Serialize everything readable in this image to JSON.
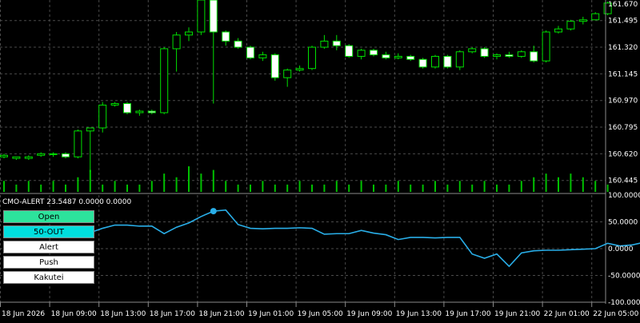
{
  "chart_data": {
    "type": "candlestick",
    "price_axis_labels": [
      "161.670",
      "161.495",
      "161.320",
      "161.145",
      "160.970",
      "160.795",
      "160.620",
      "160.445"
    ],
    "price_axis_values": [
      161.67,
      161.495,
      161.32,
      161.145,
      160.97,
      160.795,
      160.62,
      160.445
    ],
    "price_range": [
      160.37,
      161.63
    ],
    "time_labels": [
      "18 Jun 2026",
      "18 Jun 09:00",
      "18 Jun 13:00",
      "18 Jun 17:00",
      "18 Jun 21:00",
      "19 Jun 01:00",
      "19 Jun 05:00",
      "19 Jun 09:00",
      "19 Jun 13:00",
      "19 Jun 17:00",
      "19 Jun 21:00",
      "22 Jun 01:00",
      "22 Jun 05:00"
    ],
    "time_label_bars": [
      0,
      4,
      8,
      12,
      16,
      20,
      24,
      28,
      32,
      36,
      40,
      44,
      48
    ],
    "candles": [
      {
        "o": 160.6,
        "h": 160.62,
        "l": 160.59,
        "c": 160.61
      },
      {
        "o": 160.59,
        "h": 160.6,
        "l": 160.58,
        "c": 160.6
      },
      {
        "o": 160.59,
        "h": 160.61,
        "l": 160.58,
        "c": 160.6
      },
      {
        "o": 160.61,
        "h": 160.63,
        "l": 160.6,
        "c": 160.62
      },
      {
        "o": 160.62,
        "h": 160.63,
        "l": 160.6,
        "c": 160.62
      },
      {
        "o": 160.62,
        "h": 160.63,
        "l": 160.59,
        "c": 160.6
      },
      {
        "o": 160.6,
        "h": 160.78,
        "l": 160.59,
        "c": 160.77
      },
      {
        "o": 160.77,
        "h": 160.79,
        "l": 160.5,
        "c": 160.79
      },
      {
        "o": 160.79,
        "h": 160.96,
        "l": 160.76,
        "c": 160.94
      },
      {
        "o": 160.94,
        "h": 160.96,
        "l": 160.93,
        "c": 160.95
      },
      {
        "o": 160.95,
        "h": 160.96,
        "l": 160.88,
        "c": 160.89
      },
      {
        "o": 160.89,
        "h": 160.91,
        "l": 160.87,
        "c": 160.9
      },
      {
        "o": 160.9,
        "h": 160.91,
        "l": 160.88,
        "c": 160.89
      },
      {
        "o": 160.89,
        "h": 161.32,
        "l": 160.88,
        "c": 161.31
      },
      {
        "o": 161.31,
        "h": 161.42,
        "l": 161.16,
        "c": 161.4
      },
      {
        "o": 161.4,
        "h": 161.45,
        "l": 161.36,
        "c": 161.42
      },
      {
        "o": 161.42,
        "h": 161.63,
        "l": 161.4,
        "c": 161.63
      },
      {
        "o": 161.63,
        "h": 161.63,
        "l": 160.95,
        "c": 161.42
      },
      {
        "o": 161.42,
        "h": 161.43,
        "l": 161.33,
        "c": 161.36
      },
      {
        "o": 161.36,
        "h": 161.38,
        "l": 161.31,
        "c": 161.32
      },
      {
        "o": 161.32,
        "h": 161.33,
        "l": 161.24,
        "c": 161.25
      },
      {
        "o": 161.25,
        "h": 161.29,
        "l": 161.23,
        "c": 161.27
      },
      {
        "o": 161.27,
        "h": 161.28,
        "l": 161.1,
        "c": 161.12
      },
      {
        "o": 161.12,
        "h": 161.18,
        "l": 161.06,
        "c": 161.17
      },
      {
        "o": 161.17,
        "h": 161.2,
        "l": 161.16,
        "c": 161.18
      },
      {
        "o": 161.18,
        "h": 161.33,
        "l": 161.17,
        "c": 161.32
      },
      {
        "o": 161.32,
        "h": 161.4,
        "l": 161.31,
        "c": 161.36
      },
      {
        "o": 161.36,
        "h": 161.4,
        "l": 161.3,
        "c": 161.33
      },
      {
        "o": 161.33,
        "h": 161.34,
        "l": 161.25,
        "c": 161.26
      },
      {
        "o": 161.26,
        "h": 161.31,
        "l": 161.24,
        "c": 161.3
      },
      {
        "o": 161.3,
        "h": 161.31,
        "l": 161.26,
        "c": 161.27
      },
      {
        "o": 161.27,
        "h": 161.29,
        "l": 161.24,
        "c": 161.25
      },
      {
        "o": 161.25,
        "h": 161.28,
        "l": 161.24,
        "c": 161.26
      },
      {
        "o": 161.26,
        "h": 161.27,
        "l": 161.23,
        "c": 161.24
      },
      {
        "o": 161.24,
        "h": 161.25,
        "l": 161.18,
        "c": 161.19
      },
      {
        "o": 161.19,
        "h": 161.27,
        "l": 161.18,
        "c": 161.26
      },
      {
        "o": 161.26,
        "h": 161.27,
        "l": 161.18,
        "c": 161.19
      },
      {
        "o": 161.19,
        "h": 161.3,
        "l": 161.17,
        "c": 161.29
      },
      {
        "o": 161.29,
        "h": 161.32,
        "l": 161.28,
        "c": 161.31
      },
      {
        "o": 161.31,
        "h": 161.32,
        "l": 161.25,
        "c": 161.26
      },
      {
        "o": 161.26,
        "h": 161.28,
        "l": 161.24,
        "c": 161.27
      },
      {
        "o": 161.27,
        "h": 161.29,
        "l": 161.25,
        "c": 161.26
      },
      {
        "o": 161.26,
        "h": 161.3,
        "l": 161.25,
        "c": 161.29
      },
      {
        "o": 161.29,
        "h": 161.33,
        "l": 161.22,
        "c": 161.23
      },
      {
        "o": 161.23,
        "h": 161.43,
        "l": 161.22,
        "c": 161.42
      },
      {
        "o": 161.42,
        "h": 161.46,
        "l": 161.41,
        "c": 161.44
      },
      {
        "o": 161.44,
        "h": 161.5,
        "l": 161.43,
        "c": 161.49
      },
      {
        "o": 161.49,
        "h": 161.52,
        "l": 161.47,
        "c": 161.5
      },
      {
        "o": 161.5,
        "h": 161.55,
        "l": 161.5,
        "c": 161.54
      },
      {
        "o": 161.54,
        "h": 161.62,
        "l": 161.53,
        "c": 161.61
      }
    ],
    "volumes": [
      3,
      2,
      3,
      2,
      3,
      2,
      4,
      6,
      2,
      3,
      2,
      2,
      3,
      5,
      4,
      7,
      5,
      6,
      3,
      2,
      2,
      3,
      2,
      2,
      3,
      2,
      2,
      3,
      2,
      3,
      2,
      2,
      3,
      2,
      2,
      3,
      2,
      3,
      2,
      3,
      2,
      2,
      3,
      4,
      5,
      4,
      5,
      4,
      3,
      2
    ],
    "volume_range": [
      0,
      7
    ],
    "indicator": {
      "label": "CMO-ALERT 23.5487 0.0000 0.0000",
      "axis_labels": [
        "100.0000",
        "50.0000",
        "0.0000",
        "-50.0000",
        "-100.0000"
      ],
      "axis_values": [
        100,
        50,
        0,
        -50,
        -100
      ],
      "values": [
        30,
        38,
        44,
        44,
        42,
        42,
        28,
        40,
        48,
        60,
        70,
        72,
        45,
        38,
        37,
        38,
        38,
        39,
        38,
        27,
        28,
        28,
        34,
        29,
        26,
        17,
        21,
        21,
        20,
        21,
        21,
        -10,
        -18,
        -10,
        -33,
        -8,
        -4,
        -3,
        -3,
        -2,
        -1,
        0,
        10,
        5,
        7,
        12,
        18,
        25,
        25
      ],
      "marker_index": 10,
      "line_color": "#29aee8",
      "marker_color": "#29aee8"
    },
    "grid": true
  },
  "buttons": [
    {
      "label": "Open",
      "bg": "#2de39c"
    },
    {
      "label": "50-OUT",
      "bg": "#00dede"
    },
    {
      "label": "Alert",
      "bg": "#ffffff"
    },
    {
      "label": "Push",
      "bg": "#ffffff"
    },
    {
      "label": "Kakutei",
      "bg": "#ffffff"
    }
  ],
  "colors": {
    "background": "#000000",
    "grid": "#4a4a4a",
    "bull_body": "#000000",
    "bear_body": "#ffffff",
    "candle_outline": "#00e000",
    "volume": "#00c000",
    "axis_text": "#ffffff"
  }
}
